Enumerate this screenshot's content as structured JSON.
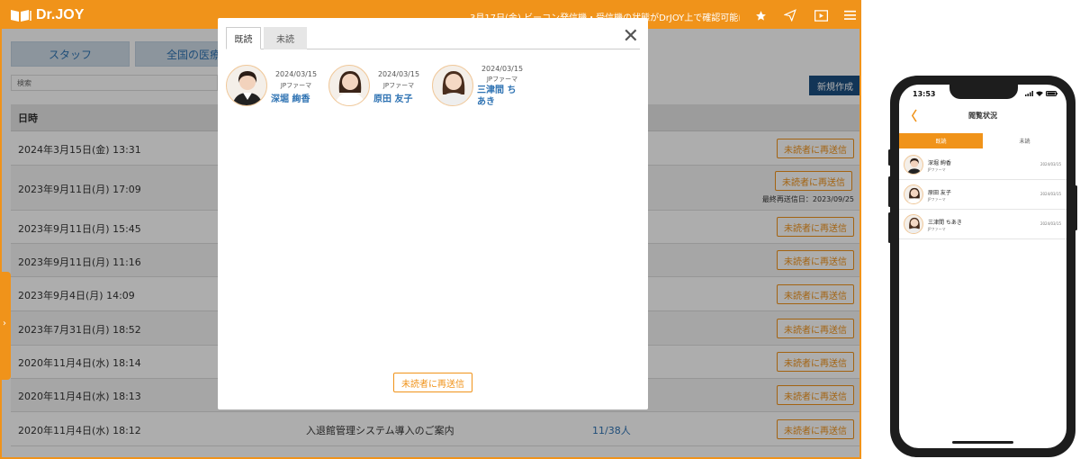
{
  "app": {
    "logo": "Dr.JOY",
    "marquee": "3月17日(金) ビーコン発信機・受信機の状態がDrJOY上で確認可能に",
    "tabs": [
      "スタッフ",
      "全国の医療機"
    ],
    "search_placeholder": "検索",
    "new_button": "新規作成",
    "table_header_date": "日時",
    "rows": [
      {
        "date": "2024年3月15日(金) 13:31",
        "title": "",
        "count": "",
        "resend": "未読者に再送信",
        "last": ""
      },
      {
        "date": "2023年9月11日(月) 17:09",
        "title": "",
        "count": "",
        "resend": "未読者に再送信",
        "last": "最終再送信日：2023/09/25"
      },
      {
        "date": "2023年9月11日(月) 15:45",
        "title": "",
        "count": "",
        "resend": "未読者に再送信",
        "last": ""
      },
      {
        "date": "2023年9月11日(月) 11:16",
        "title": "",
        "count": "",
        "resend": "未読者に再送信",
        "last": ""
      },
      {
        "date": "2023年9月4日(月) 14:09",
        "title": "",
        "count": "",
        "resend": "未読者に再送信",
        "last": ""
      },
      {
        "date": "2023年7月31日(月) 18:52",
        "title": "",
        "count": "",
        "resend": "未読者に再送信",
        "last": ""
      },
      {
        "date": "2020年11月4日(水) 18:14",
        "title": "",
        "count": "",
        "resend": "未読者に再送信",
        "last": ""
      },
      {
        "date": "2020年11月4日(水) 18:13",
        "title": "",
        "count": "",
        "resend": "未読者に再送信",
        "last": ""
      },
      {
        "date": "2020年11月4日(水) 18:12",
        "title": "入退館管理システム導入のご案内",
        "count": "11/38人",
        "resend": "未読者に再送信",
        "last": ""
      }
    ]
  },
  "modal": {
    "tab_read": "既読",
    "tab_unread": "未読",
    "close": "✕",
    "readers": [
      {
        "date": "2024/03/15",
        "company": "JPファーマ",
        "name": "深堀 絢香"
      },
      {
        "date": "2024/03/15",
        "company": "JPファーマ",
        "name": "原田 友子"
      },
      {
        "date": "2024/03/15",
        "company": "JPファーマ",
        "name": "三津間 ちあき"
      }
    ],
    "resend": "未読者に再送信"
  },
  "phone": {
    "time": "13:53",
    "title": "閲覧状況",
    "back": "〈",
    "tab_read": "既読",
    "tab_unread": "未読",
    "rows": [
      {
        "name": "深堀 絢香",
        "company": "JPファーマ",
        "date": "2024/03/15"
      },
      {
        "name": "原田 友子",
        "company": "JPファーマ",
        "date": "2024/03/15"
      },
      {
        "name": "三津間 ちあき",
        "company": "JPファーマ",
        "date": "2024/03/15"
      }
    ]
  },
  "colors": {
    "accent": "#f0931a",
    "link": "#2f73b3",
    "navy": "#1b4e80"
  }
}
